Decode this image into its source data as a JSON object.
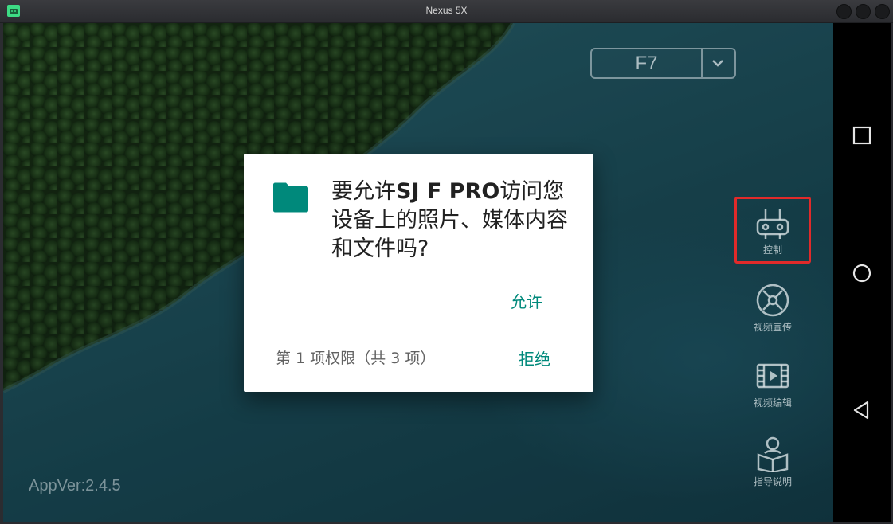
{
  "window": {
    "title": "Nexus 5X",
    "icon": "android-icon"
  },
  "app": {
    "model_selector": {
      "value": "F7",
      "icon": "chevron-down-icon"
    },
    "side_menu": [
      {
        "label": "控制",
        "icon": "remote-controller-icon",
        "active": true
      },
      {
        "label": "视频宣传",
        "icon": "drone-propeller-icon",
        "active": false
      },
      {
        "label": "视频编辑",
        "icon": "film-play-icon",
        "active": false
      },
      {
        "label": "指导说明",
        "icon": "user-guide-icon",
        "active": false
      }
    ],
    "app_version": "AppVer:2.4.5"
  },
  "dialog": {
    "icon": "folder-icon",
    "message_prefix": "要允许",
    "app_name": "SJ F PRO",
    "message_suffix": "访问您设备上的照片、媒体内容和文件吗?",
    "allow_label": "允许",
    "deny_label": "拒绝",
    "permission_counter": "第 1 项权限（共 3 项）"
  },
  "navbar": {
    "recents_icon": "square-recents-icon",
    "home_icon": "circle-home-icon",
    "back_icon": "triangle-back-icon"
  },
  "colors": {
    "accent": "#00897b",
    "highlight": "#e12a2a",
    "water": "#1d5462",
    "dialog_bg": "#ffffff"
  }
}
